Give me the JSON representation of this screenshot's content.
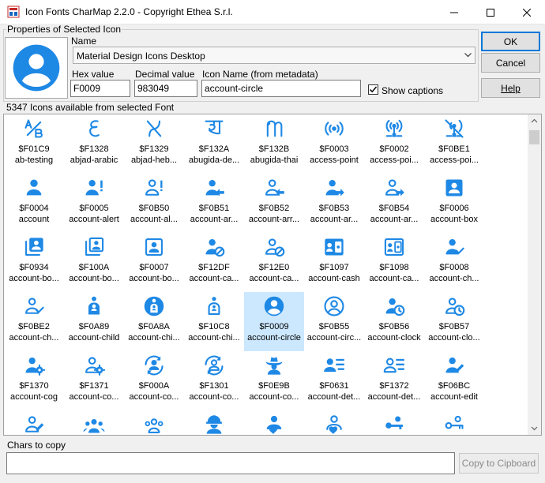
{
  "window": {
    "title": "Icon Fonts CharMap 2.2.0 - Copyright Ethea S.r.l."
  },
  "properties": {
    "legend": "Properties of Selected Icon",
    "name_label": "Name",
    "font_name": "Material Design Icons Desktop",
    "hex_label": "Hex value",
    "hex_value": "F0009",
    "decimal_label": "Decimal value",
    "decimal_value": "983049",
    "icon_name_label": "Icon Name (from metadata)",
    "icon_name_value": "account-circle",
    "show_captions_label": "Show captions",
    "show_captions_checked": true
  },
  "buttons": {
    "ok": "OK",
    "cancel": "Cancel",
    "help": "Help",
    "copy": "Copy to Cipboard"
  },
  "count_label": "5347 Icons available from selected Font",
  "accent_color": "#1e88e5",
  "selection_color": "#cce8ff",
  "icons": [
    {
      "hex": "$F01C9",
      "name": "ab-testing",
      "icon": "ab-testing-icon"
    },
    {
      "hex": "$F1328",
      "name": "abjad-arabic",
      "icon": "abjad-arabic-icon"
    },
    {
      "hex": "$F1329",
      "name": "abjad-heb...",
      "icon": "abjad-hebrew-icon"
    },
    {
      "hex": "$F132A",
      "name": "abugida-de...",
      "icon": "abugida-devanagari-icon"
    },
    {
      "hex": "$F132B",
      "name": "abugida-thai",
      "icon": "abugida-thai-icon"
    },
    {
      "hex": "$F0003",
      "name": "access-point",
      "icon": "access-point-icon"
    },
    {
      "hex": "$F0002",
      "name": "access-poi...",
      "icon": "access-point-network-icon"
    },
    {
      "hex": "$F0BE1",
      "name": "access-poi...",
      "icon": "access-point-network-off-icon"
    },
    {
      "hex": "$F0004",
      "name": "account",
      "icon": "account-icon"
    },
    {
      "hex": "$F0005",
      "name": "account-alert",
      "icon": "account-alert-icon"
    },
    {
      "hex": "$F0B50",
      "name": "account-al...",
      "icon": "account-alert-outline-icon"
    },
    {
      "hex": "$F0B51",
      "name": "account-ar...",
      "icon": "account-arrow-left-icon"
    },
    {
      "hex": "$F0B52",
      "name": "account-arr...",
      "icon": "account-arrow-left-outline-icon"
    },
    {
      "hex": "$F0B53",
      "name": "account-ar...",
      "icon": "account-arrow-right-icon"
    },
    {
      "hex": "$F0B54",
      "name": "account-ar...",
      "icon": "account-arrow-right-outline-icon"
    },
    {
      "hex": "$F0006",
      "name": "account-box",
      "icon": "account-box-icon"
    },
    {
      "hex": "$F0934",
      "name": "account-bo...",
      "icon": "account-box-multiple-icon"
    },
    {
      "hex": "$F100A",
      "name": "account-bo...",
      "icon": "account-box-multiple-outline-icon"
    },
    {
      "hex": "$F0007",
      "name": "account-bo...",
      "icon": "account-box-outline-icon"
    },
    {
      "hex": "$F12DF",
      "name": "account-ca...",
      "icon": "account-cancel-icon"
    },
    {
      "hex": "$F12E0",
      "name": "account-ca...",
      "icon": "account-cancel-outline-icon"
    },
    {
      "hex": "$F1097",
      "name": "account-cash",
      "icon": "account-cash-icon"
    },
    {
      "hex": "$F1098",
      "name": "account-ca...",
      "icon": "account-cash-outline-icon"
    },
    {
      "hex": "$F0008",
      "name": "account-ch...",
      "icon": "account-check-icon"
    },
    {
      "hex": "$F0BE2",
      "name": "account-ch...",
      "icon": "account-check-outline-icon"
    },
    {
      "hex": "$F0A89",
      "name": "account-child",
      "icon": "account-child-icon"
    },
    {
      "hex": "$F0A8A",
      "name": "account-chi...",
      "icon": "account-child-circle-icon"
    },
    {
      "hex": "$F10C8",
      "name": "account-chi...",
      "icon": "account-child-outline-icon"
    },
    {
      "hex": "$F0009",
      "name": "account-circle",
      "icon": "account-circle-icon",
      "selected": true
    },
    {
      "hex": "$F0B55",
      "name": "account-circ...",
      "icon": "account-circle-outline-icon"
    },
    {
      "hex": "$F0B56",
      "name": "account-clock",
      "icon": "account-clock-icon"
    },
    {
      "hex": "$F0B57",
      "name": "account-clo...",
      "icon": "account-clock-outline-icon"
    },
    {
      "hex": "$F1370",
      "name": "account-cog",
      "icon": "account-cog-icon"
    },
    {
      "hex": "$F1371",
      "name": "account-co...",
      "icon": "account-cog-outline-icon"
    },
    {
      "hex": "$F000A",
      "name": "account-co...",
      "icon": "account-convert-icon"
    },
    {
      "hex": "$F1301",
      "name": "account-co...",
      "icon": "account-convert-outline-icon"
    },
    {
      "hex": "$F0E9B",
      "name": "account-co...",
      "icon": "account-cowboy-hat-icon"
    },
    {
      "hex": "$F0631",
      "name": "account-det...",
      "icon": "account-details-icon"
    },
    {
      "hex": "$F1372",
      "name": "account-det...",
      "icon": "account-details-outline-icon"
    },
    {
      "hex": "$F06BC",
      "name": "account-edit",
      "icon": "account-edit-icon"
    },
    {
      "hex": "",
      "name": "",
      "icon": "account-edit-outline-icon"
    },
    {
      "hex": "",
      "name": "",
      "icon": "account-group-icon"
    },
    {
      "hex": "",
      "name": "",
      "icon": "account-group-outline-icon"
    },
    {
      "hex": "",
      "name": "",
      "icon": "account-hard-hat-icon"
    },
    {
      "hex": "",
      "name": "",
      "icon": "account-heart-icon"
    },
    {
      "hex": "",
      "name": "",
      "icon": "account-heart-outline-icon"
    },
    {
      "hex": "",
      "name": "",
      "icon": "account-key-icon"
    },
    {
      "hex": "",
      "name": "",
      "icon": "account-key-outline-icon"
    }
  ],
  "chars_label": "Chars to copy",
  "chars_value": ""
}
